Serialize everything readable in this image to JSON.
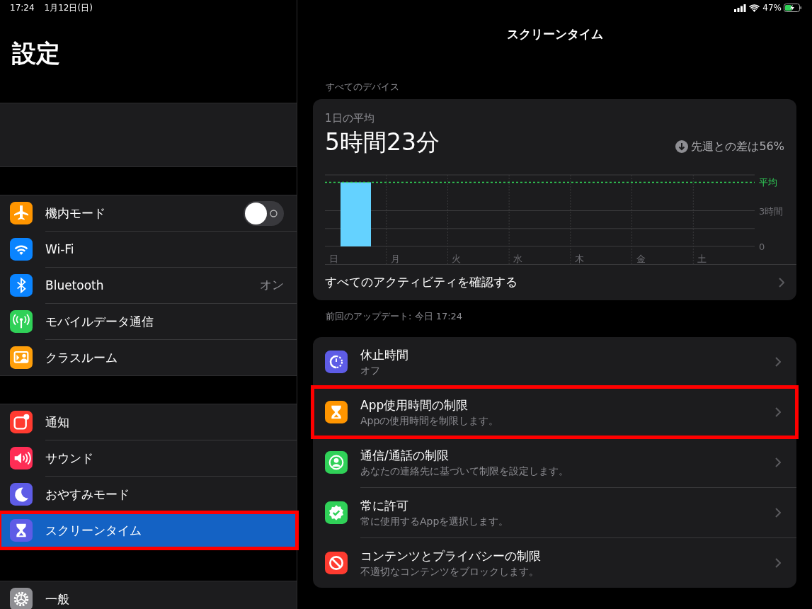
{
  "status_bar": {
    "time": "17:24",
    "date": "1月12日(日)",
    "battery": "47%"
  },
  "sidebar": {
    "title": "設定",
    "groups": [
      {
        "items": [
          {
            "kind": "toggle",
            "label": "機内モード",
            "color": "#ff9500",
            "on": false,
            "selected": false,
            "highlighted": false
          },
          {
            "kind": "link",
            "label": "Wi-Fi",
            "color": "#0a84ff",
            "selected": false,
            "highlighted": false
          },
          {
            "kind": "value",
            "label": "Bluetooth",
            "value": "オン",
            "color": "#0a84ff",
            "selected": false,
            "highlighted": false
          },
          {
            "kind": "link",
            "label": "モバイルデータ通信",
            "color": "#30d158",
            "selected": false,
            "highlighted": false
          },
          {
            "kind": "link",
            "label": "クラスルーム",
            "color": "#ff9f0a",
            "selected": false,
            "highlighted": false
          }
        ]
      },
      {
        "items": [
          {
            "kind": "link",
            "label": "通知",
            "color": "#ff3b30",
            "selected": false,
            "highlighted": false
          },
          {
            "kind": "link",
            "label": "サウンド",
            "color": "#ff2d55",
            "selected": false,
            "highlighted": false
          },
          {
            "kind": "link",
            "label": "おやすみモード",
            "color": "#5e5ce6",
            "selected": false,
            "highlighted": false
          },
          {
            "kind": "link",
            "label": "スクリーンタイム",
            "color": "#5e5ce6",
            "selected": true,
            "highlighted": true
          }
        ]
      },
      {
        "items": [
          {
            "kind": "link",
            "label": "一般",
            "color": "#8e8e93",
            "selected": false,
            "highlighted": false
          }
        ]
      }
    ]
  },
  "detail": {
    "title": "スクリーンタイム",
    "section_label": "すべてのデバイス",
    "summary": {
      "caption": "1日の平均",
      "total": "5時間23分",
      "change": "先週との差は56%",
      "chart_data": {
        "type": "bar",
        "categories": [
          "日",
          "月",
          "火",
          "水",
          "木",
          "金",
          "土"
        ],
        "values": [
          5.38,
          0,
          0,
          0,
          0,
          0,
          0
        ],
        "ylim": [
          0,
          6
        ],
        "yticks": [
          0,
          {
            "value": 3,
            "label": "3時間"
          }
        ],
        "ref_lines": [
          {
            "axis": "y",
            "value": 5.38,
            "label": "平均",
            "color": "#30d158"
          }
        ]
      },
      "link": "すべてのアクティビティを確認する"
    },
    "updated": "前回のアップデート: 今日 17:24",
    "items": [
      {
        "title": "休止時間",
        "subtitle": "オフ",
        "color": "#5e5ce6",
        "highlighted": false
      },
      {
        "title": "App使用時間の制限",
        "subtitle": "Appの使用時間を制限します。",
        "color": "#ff9500",
        "highlighted": true
      },
      {
        "title": "通信/通話の制限",
        "subtitle": "あなたの連絡先に基づいて制限を設定します。",
        "color": "#30d158",
        "highlighted": false
      },
      {
        "title": "常に許可",
        "subtitle": "常に使用するAppを選択します。",
        "color": "#30d158",
        "highlighted": false
      },
      {
        "title": "コンテンツとプライバシーの制限",
        "subtitle": "不適切なコンテンツをブロックします。",
        "color": "#ff3b30",
        "highlighted": false
      }
    ]
  }
}
